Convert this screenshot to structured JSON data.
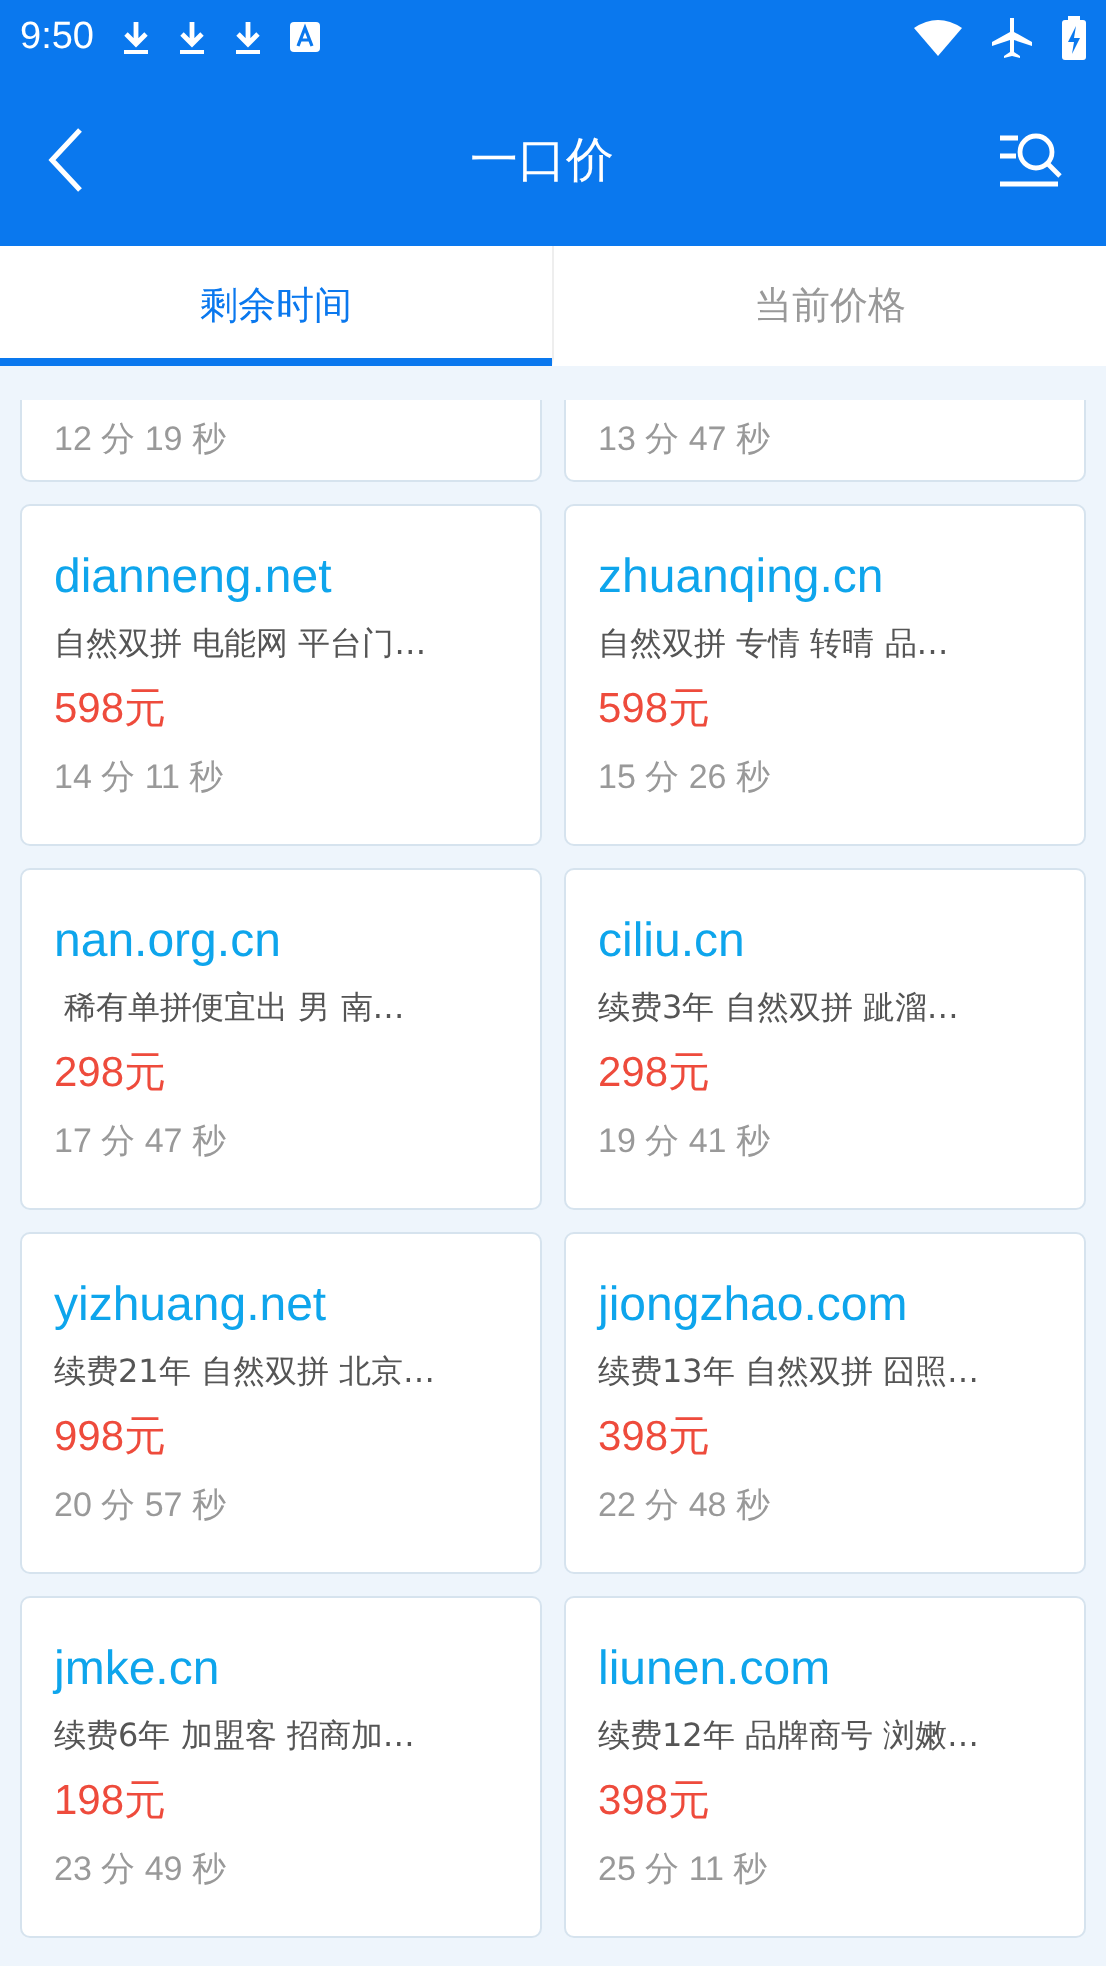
{
  "status_bar": {
    "time": "9:50"
  },
  "app_bar": {
    "title": "一口价"
  },
  "tabs": [
    {
      "label": "剩余时间",
      "selected": true
    },
    {
      "label": "当前价格",
      "selected": false
    }
  ],
  "items": [
    {
      "kind": "partial",
      "time": "12 分 19 秒"
    },
    {
      "kind": "partial",
      "time": "13 分 47 秒"
    },
    {
      "kind": "full",
      "domain": "dianneng.net",
      "description": "自然双拼 电能网 平台门…",
      "price": "598元",
      "time": "14 分 11 秒"
    },
    {
      "kind": "full",
      "domain": "zhuanqing.cn",
      "description": "自然双拼 专情 转晴 品…",
      "price": "598元",
      "time": "15 分 26 秒"
    },
    {
      "kind": "full",
      "domain": "nan.org.cn",
      "description": " 稀有单拼便宜出 男 南…",
      "price": "298元",
      "time": "17 分 47 秒"
    },
    {
      "kind": "full",
      "domain": "ciliu.cn",
      "description": "续费3年 自然双拼 跐溜…",
      "price": "298元",
      "time": "19 分 41 秒"
    },
    {
      "kind": "full",
      "domain": "yizhuang.net",
      "description": "续费21年 自然双拼 北京…",
      "price": "998元",
      "time": "20 分 57 秒"
    },
    {
      "kind": "full",
      "domain": "jiongzhao.com",
      "description": "续费13年 自然双拼 囧照…",
      "price": "398元",
      "time": "22 分 48 秒"
    },
    {
      "kind": "full",
      "domain": "jmke.cn",
      "description": "续费6年 加盟客 招商加…",
      "price": "198元",
      "time": "23 分 49 秒"
    },
    {
      "kind": "full",
      "domain": "liunen.com",
      "description": "续费12年 品牌商号 浏嫩…",
      "price": "398元",
      "time": "25 分 11 秒"
    }
  ]
}
